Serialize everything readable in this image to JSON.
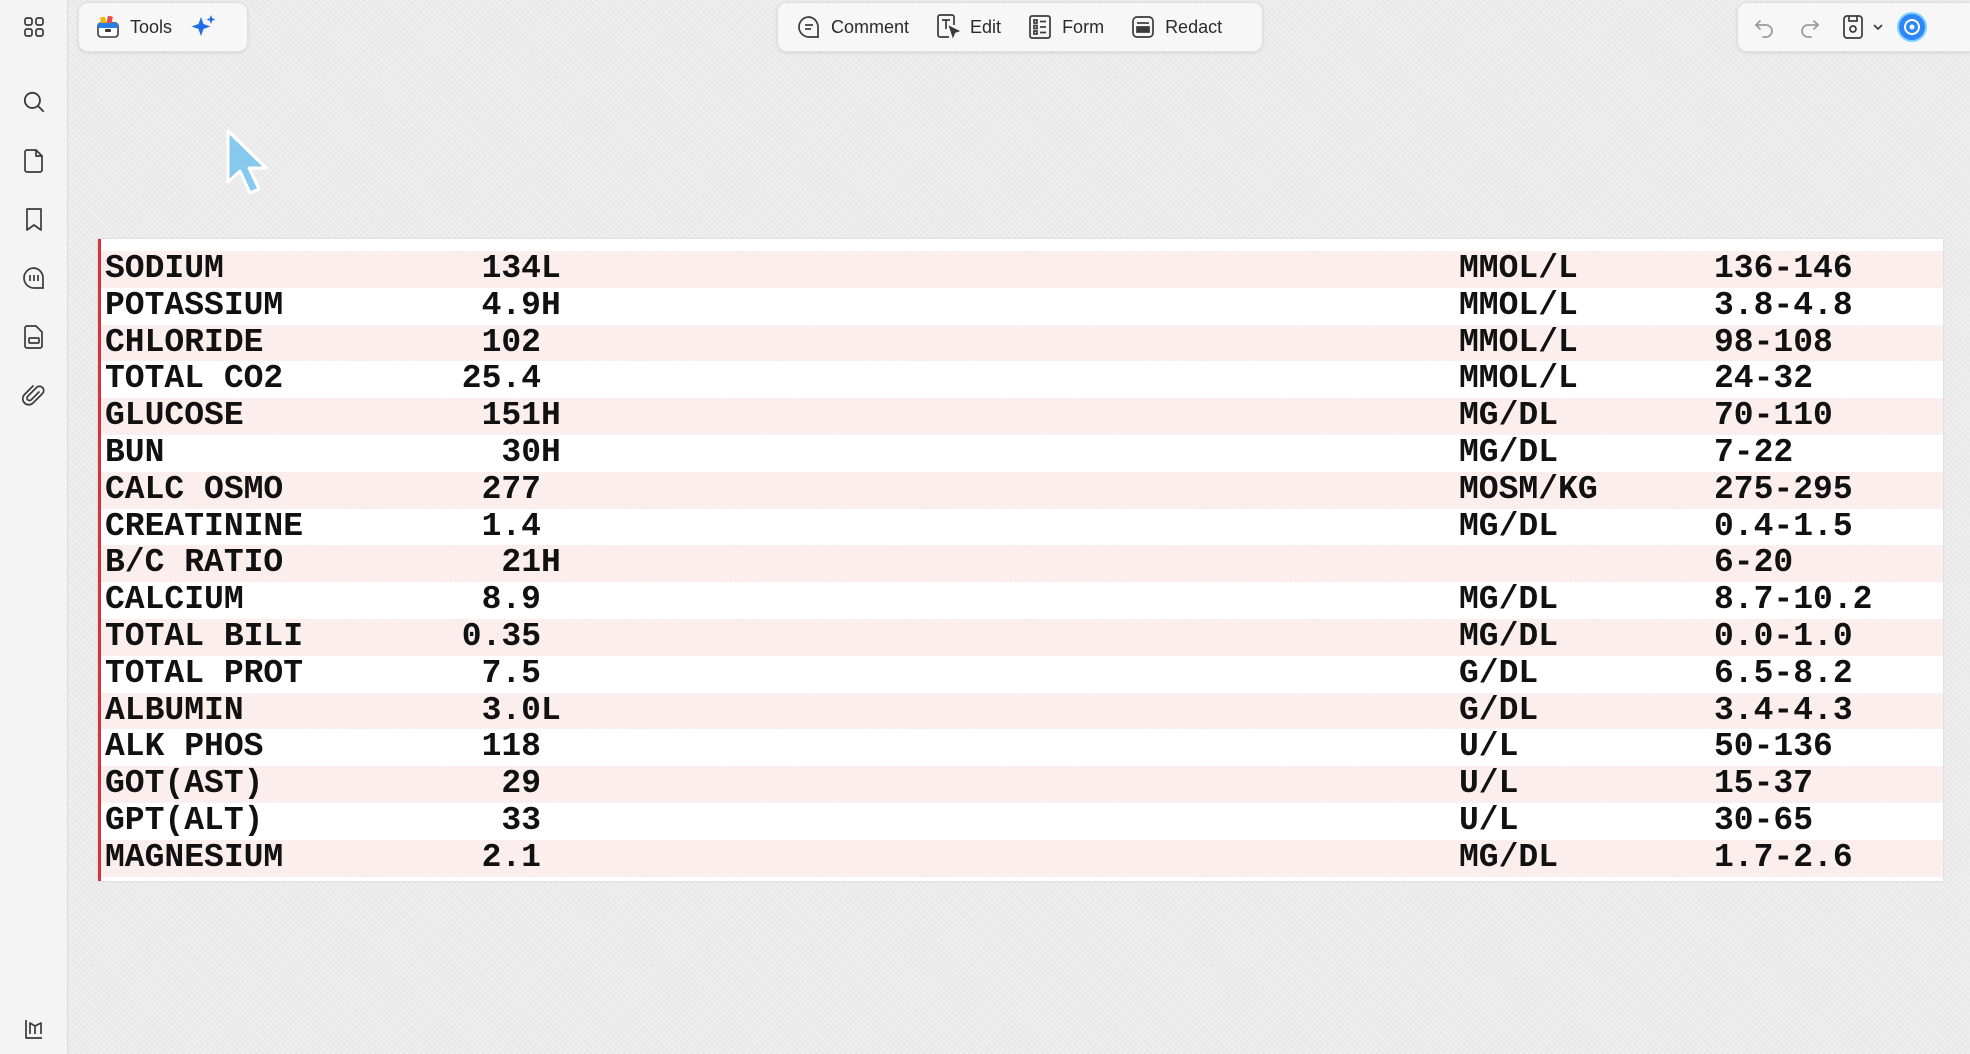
{
  "toolbar": {
    "tools_label": "Tools",
    "comment_label": "Comment",
    "edit_label": "Edit",
    "form_label": "Form",
    "redact_label": "Redact"
  },
  "icons": {
    "rail": [
      "grid-icon",
      "search-icon",
      "page-icon",
      "bookmark-icon",
      "comments-icon",
      "stamp-icon",
      "paperclip-icon",
      "layers-icon"
    ],
    "toolbar": [
      "toolbox-icon",
      "sparkle-icon",
      "comment-icon",
      "edit-text-icon",
      "form-icon",
      "redact-icon",
      "undo-icon",
      "redo-icon",
      "save-icon",
      "chevron-down-icon",
      "assistant-icon"
    ]
  },
  "colors": {
    "accent_blue": "#1e6fe8",
    "margin_line": "#d6343c",
    "row_shade": "#fcebeb"
  },
  "lab_results": [
    {
      "name": "SODIUM",
      "value": "134",
      "flag": "L",
      "unit": "MMOL/L",
      "range": "136-146"
    },
    {
      "name": "POTASSIUM",
      "value": "4.9",
      "flag": "H",
      "unit": "MMOL/L",
      "range": "3.8-4.8"
    },
    {
      "name": "CHLORIDE",
      "value": "102",
      "flag": "",
      "unit": "MMOL/L",
      "range": "98-108"
    },
    {
      "name": "TOTAL CO2",
      "value": "25.4",
      "flag": "",
      "unit": "MMOL/L",
      "range": "24-32"
    },
    {
      "name": "GLUCOSE",
      "value": "151",
      "flag": "H",
      "unit": "MG/DL",
      "range": "70-110"
    },
    {
      "name": "BUN",
      "value": "30",
      "flag": "H",
      "unit": "MG/DL",
      "range": "7-22"
    },
    {
      "name": "CALC OSMO",
      "value": "277",
      "flag": "",
      "unit": "MOSM/KG",
      "range": "275-295"
    },
    {
      "name": "CREATININE",
      "value": "1.4",
      "flag": "",
      "unit": "MG/DL",
      "range": "0.4-1.5"
    },
    {
      "name": "B/C RATIO",
      "value": "21",
      "flag": "H",
      "unit": "",
      "range": "6-20"
    },
    {
      "name": "CALCIUM",
      "value": "8.9",
      "flag": "",
      "unit": "MG/DL",
      "range": "8.7-10.2"
    },
    {
      "name": "TOTAL BILI",
      "value": "0.35",
      "flag": "",
      "unit": "MG/DL",
      "range": "0.0-1.0"
    },
    {
      "name": "TOTAL PROT",
      "value": "7.5",
      "flag": "",
      "unit": "G/DL",
      "range": "6.5-8.2"
    },
    {
      "name": "ALBUMIN",
      "value": "3.0",
      "flag": "L",
      "unit": "G/DL",
      "range": "3.4-4.3"
    },
    {
      "name": "ALK PHOS",
      "value": "118",
      "flag": "",
      "unit": "U/L",
      "range": "50-136"
    },
    {
      "name": "GOT(AST)",
      "value": "29",
      "flag": "",
      "unit": "U/L",
      "range": "15-37"
    },
    {
      "name": "GPT(ALT)",
      "value": "33",
      "flag": "",
      "unit": "U/L",
      "range": "30-65"
    },
    {
      "name": "MAGNESIUM",
      "value": "2.1",
      "flag": "",
      "unit": "MG/DL",
      "range": "1.7-2.6"
    }
  ]
}
